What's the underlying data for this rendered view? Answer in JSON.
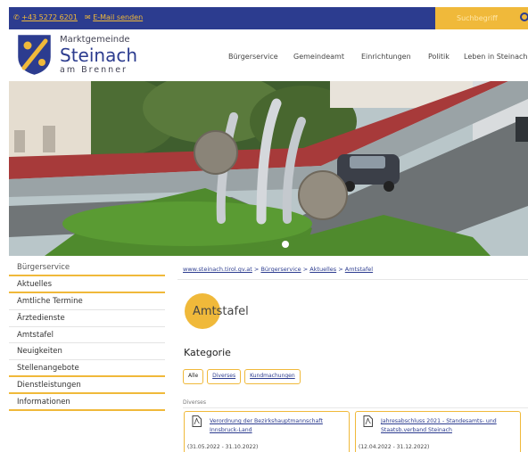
{
  "topbar": {
    "phone": "+43 5272 6201",
    "email": "E-Mail senden",
    "search_placeholder": "Suchbegriff",
    "phone_icon": "phone-icon",
    "email_icon": "mail-icon",
    "search_icon": "search-icon"
  },
  "brand": {
    "line1": "Marktgemeinde",
    "line2": "Steinach",
    "line3": "am Brenner"
  },
  "nav": [
    "Bürgerservice",
    "Gemeindeamt",
    "Einrichtungen",
    "Politik",
    "Leben in Steinach"
  ],
  "sidebar": [
    "Bürgerservice",
    "Aktuelles",
    "Amtliche Termine",
    "Ärztedienste",
    "Amtstafel",
    "Neuigkeiten",
    "Stellenangebote",
    "Dienstleistungen",
    "Informationen"
  ],
  "breadcrumb": {
    "home": "www.steinach.tirol.gv.at",
    "sep": ">",
    "level1": "Bürgerservice",
    "level2": "Aktuelles",
    "level3": "Amtstafel"
  },
  "page_title": "Amtstafel",
  "kategorie": {
    "heading": "Kategorie",
    "pills": [
      "Alle",
      "Diverses",
      "Kundmachungen"
    ]
  },
  "section_label": "Diverses",
  "cards": [
    {
      "title": "Verordnung der Bezirkshauptmannschaft Innsbruck-Land",
      "date": "(31.05.2022 - 31.10.2022)",
      "icon": "pdf-icon"
    },
    {
      "title": "Jahresabschluss 2021 - Standesamts- und Staatsb.verband Steinach",
      "date": "(12.04.2022 - 31.12.2022)",
      "icon": "pdf-icon"
    }
  ],
  "colors": {
    "brand_blue": "#2c3c8f",
    "accent_gold": "#f0b93a"
  }
}
